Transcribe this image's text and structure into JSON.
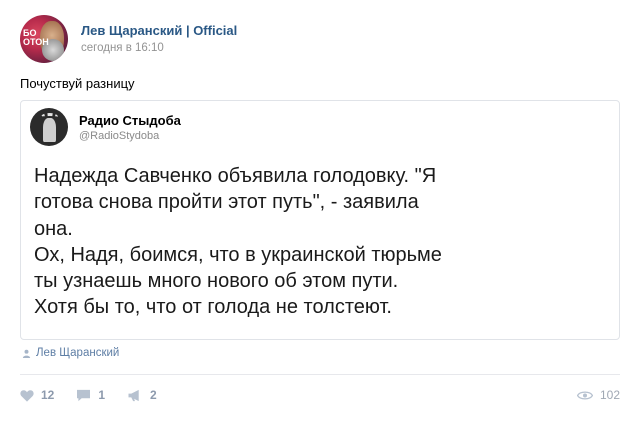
{
  "post": {
    "author_name": "Лев Щаранский | Official",
    "time": "сегодня в 16:10",
    "text": "Почуствуй разницу",
    "avatar_text": "БО\nОТОН"
  },
  "quote": {
    "name": "Радио Стыдоба",
    "handle": "@RadioStydoba",
    "lines": [
      "Надежда Савченко объявила голодовку. \"Я",
      "готова снова пройти этот путь\", - заявила",
      "она.",
      "Ох, Надя, боимся, что в украинской тюрьме",
      "ты узнаешь много нового об этом пути.",
      "Хотя бы то, что от голода не толстеют."
    ]
  },
  "signer": {
    "name": "Лев Щаранский",
    "icon": "person-icon"
  },
  "actions": {
    "likes": "12",
    "comments": "1",
    "reposts": "2",
    "views": "102"
  },
  "colors": {
    "link": "#2a5885",
    "muted": "#939393",
    "action": "#8d9aad",
    "border": "#e0e3e8"
  }
}
